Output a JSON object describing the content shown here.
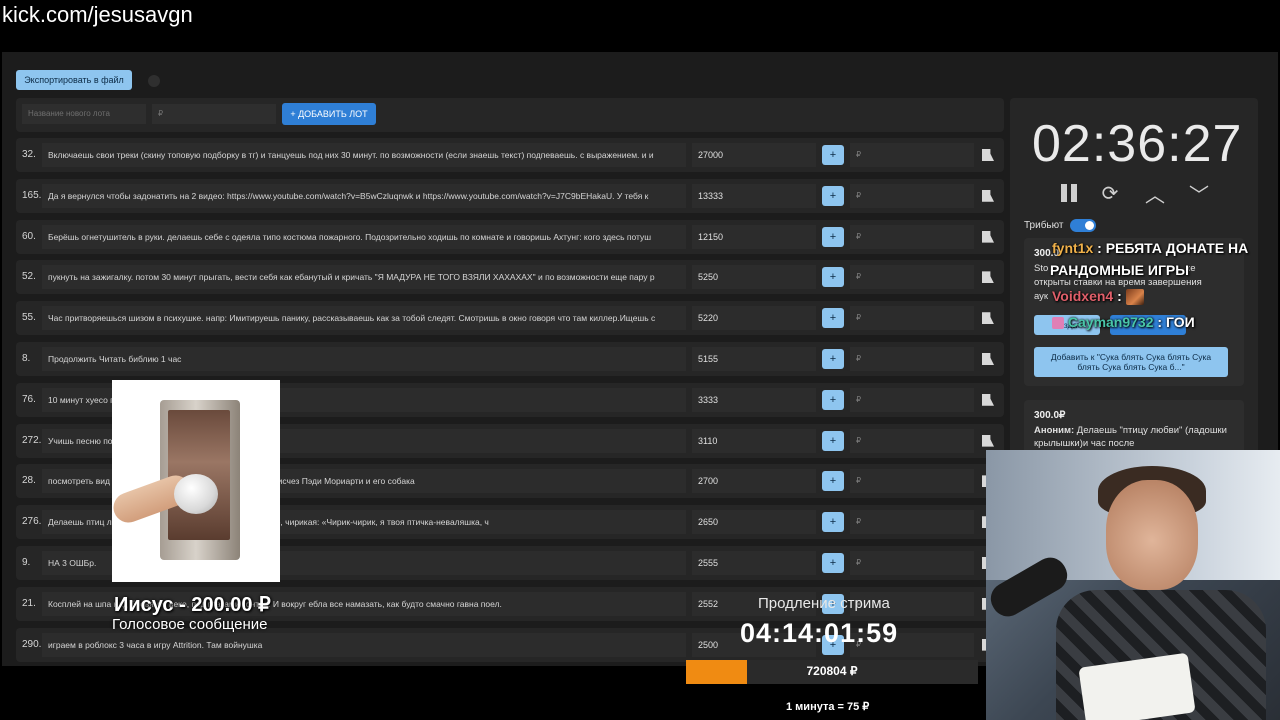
{
  "url": "kick.com/jesusavgn",
  "toolbar": {
    "export_label": "Экспортировать в файл"
  },
  "new_lot": {
    "name_placeholder": "Название нового лота",
    "price_placeholder": "₽",
    "add_label": "+ ДОБАВИТЬ ЛОТ"
  },
  "lots": [
    {
      "num": "32.",
      "text": "Включаешь свои треки (скину топовую подборку в тг) и танцуешь под них 30 минут. по возможности (если знаешь текст) подпеваешь. с выражением. и и",
      "amount": "27000",
      "rub": "₽"
    },
    {
      "num": "165.",
      "text": "Да я вернулся чтобы задонатить на 2 видео: https://www.youtube.com/watch?v=B5wCzluqnwk и https://www.youtube.com/watch?v=J7C9bEHakaU. У тебя к",
      "amount": "13333",
      "rub": "₽"
    },
    {
      "num": "60.",
      "text": "Берёшь огнетушитель в руки. делаешь себе с одеяла типо костюма пожарного. Подозрительно ходишь по комнате и говоришь Ахтунг: кого здесь потуш",
      "amount": "12150",
      "rub": "₽"
    },
    {
      "num": "52.",
      "text": "пукнуть на зажигалку. потом 30 минут прыгать, вести себя как ебанутый и кричать \"Я МАДУРА НЕ ТОГО ВЗЯЛИ ХАХАХАХ\" и по возможности еще пару р",
      "amount": "5250",
      "rub": "₽"
    },
    {
      "num": "55.",
      "text": "Час притворяешься шизом в психушке. напр: Имитируешь панику, рассказываешь как за тобой следят. Смотришь в окно говоря что там киллер.Ищешь с",
      "amount": "5220",
      "rub": "₽"
    },
    {
      "num": "8.",
      "text": "Продолжить Читать библию 1 час",
      "amount": "5155",
      "rub": "₽"
    },
    {
      "num": "76.",
      "text": "10 минут хуесо                              позором, несмотря на таймер",
      "amount": "3333",
      "rub": "₽"
    },
    {
      "num": "272.",
      "text": "Учишь песню                              полностью не выучишь, а в конце споёшь её",
      "amount": "3110",
      "rub": "₽"
    },
    {
      "num": "28.",
      "text": "посмотреть вид                             населением из 11 человек, где загадочно исчез Пэди Мориарти и его собака",
      "amount": "2700",
      "rub": "₽"
    },
    {
      "num": "276.",
      "text": "Делаешь птиц                              летаешь вокруг камеры прыжками на месте, чирикая: «Чирик-чирик, я твоя птичка-неваляшка, ч",
      "amount": "2650",
      "rub": "₽"
    },
    {
      "num": "9.",
      "text": "НА 3 ОШБр.",
      "amount": "2555",
      "rub": "₽"
    },
    {
      "num": "21.",
      "text": "Косплей на шпа                             над бровями, веко, под глазами контур. И вокруг ебла все намазать, как будто смачно гавна поел.",
      "amount": "2552",
      "rub": "₽"
    },
    {
      "num": "290.",
      "text": "играем в роблокс 3 часа в игру Attrition. Там войнушка",
      "amount": "2500",
      "rub": "₽"
    }
  ],
  "timer": {
    "value": "02:36:27",
    "pause_icon": "pause-icon",
    "reset_icon": "refresh-icon",
    "up_icon": "chevron-up-icon",
    "down_icon": "chevron-down-icon"
  },
  "tribute": {
    "label": "Трибьют",
    "enabled": true
  },
  "donation1": {
    "amount": "300.0",
    "line1": "Sto",
    "line1b": "ке",
    "line2": "открыты ставки на время завершения",
    "line3": "аук",
    "create_label": "Создат",
    "add_to_label": "Добавить к \"Сука блять Сука блять Сука блять Сука блять Сука б...\""
  },
  "donation2": {
    "amount": "300.0₽",
    "author": "Аноним:",
    "text": " Делаешь \"птицу любви\" (ладошки крылышки)и час после"
  },
  "chat": [
    {
      "user": "fynt1x",
      "sep": " : ",
      "msg": "РЕБЯТА ДОНАТЕ НА"
    },
    {
      "msg": "РАНДОМНЫЕ ИГРЫ"
    },
    {
      "user": "Voidxen4",
      "sep": " : "
    },
    {
      "user": "Cayman9732",
      "sep": " : ",
      "msg": "ГОИ"
    }
  ],
  "alert": {
    "name": "Иисус - 200.00 ₽",
    "subtitle": "Голосовое сообщение"
  },
  "extension": {
    "label": "Продление стрима",
    "timer": "04:14:01:59",
    "total": "720804 ₽",
    "progress_percent": 21,
    "rate": "1 минута = 75 ₽"
  },
  "colors": {
    "accent_blue": "#2f7fd6",
    "light_blue": "#8ec5ef",
    "progress_orange": "#f08b12"
  }
}
